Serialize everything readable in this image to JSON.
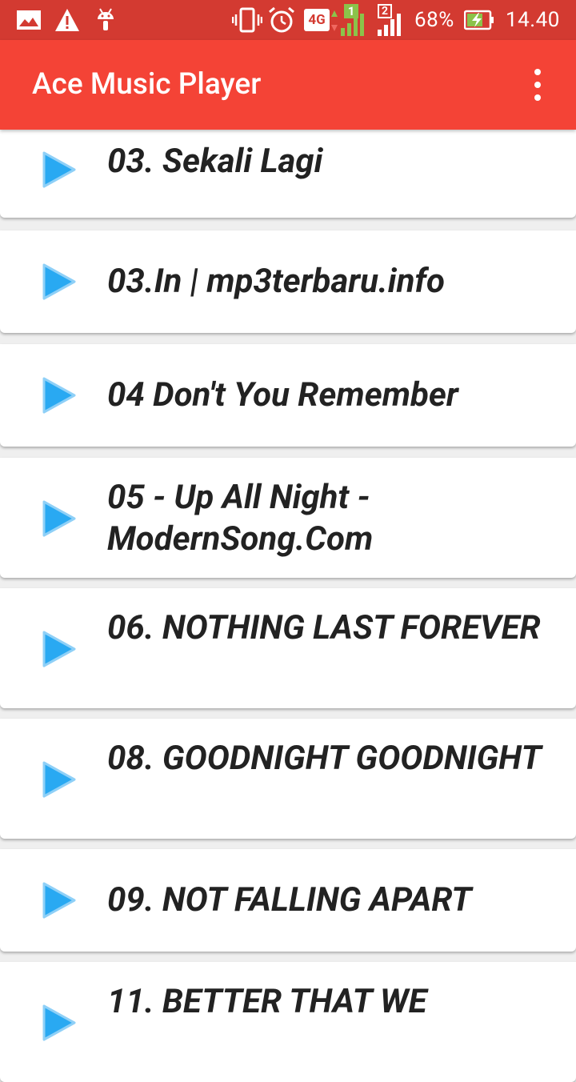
{
  "status_bar": {
    "battery": "68%",
    "time": "14.40",
    "network_type": "4G",
    "sim1_label": "1",
    "sim2_label": "2",
    "icons": [
      "gallery-icon",
      "warning-icon",
      "android-icon",
      "vibrate-icon",
      "alarm-icon",
      "signal-icon",
      "battery-charging-icon"
    ]
  },
  "app_bar": {
    "title": "Ace Music Player",
    "menu_icon": "more-vert-icon",
    "color": "#f44336"
  },
  "songs": [
    {
      "title": "03. Sekali Lagi"
    },
    {
      "title": "03.In | mp3terbaru.info"
    },
    {
      "title": "04 Don't You Remember"
    },
    {
      "title": "05 - Up All Night - ModernSong.Com"
    },
    {
      "title": "06. NOTHING LAST FOREVER"
    },
    {
      "title": "08. GOODNIGHT GOODNIGHT"
    },
    {
      "title": "09. NOT FALLING APART"
    },
    {
      "title": "11. BETTER THAT WE"
    }
  ],
  "accent_color": "#29a9f2"
}
